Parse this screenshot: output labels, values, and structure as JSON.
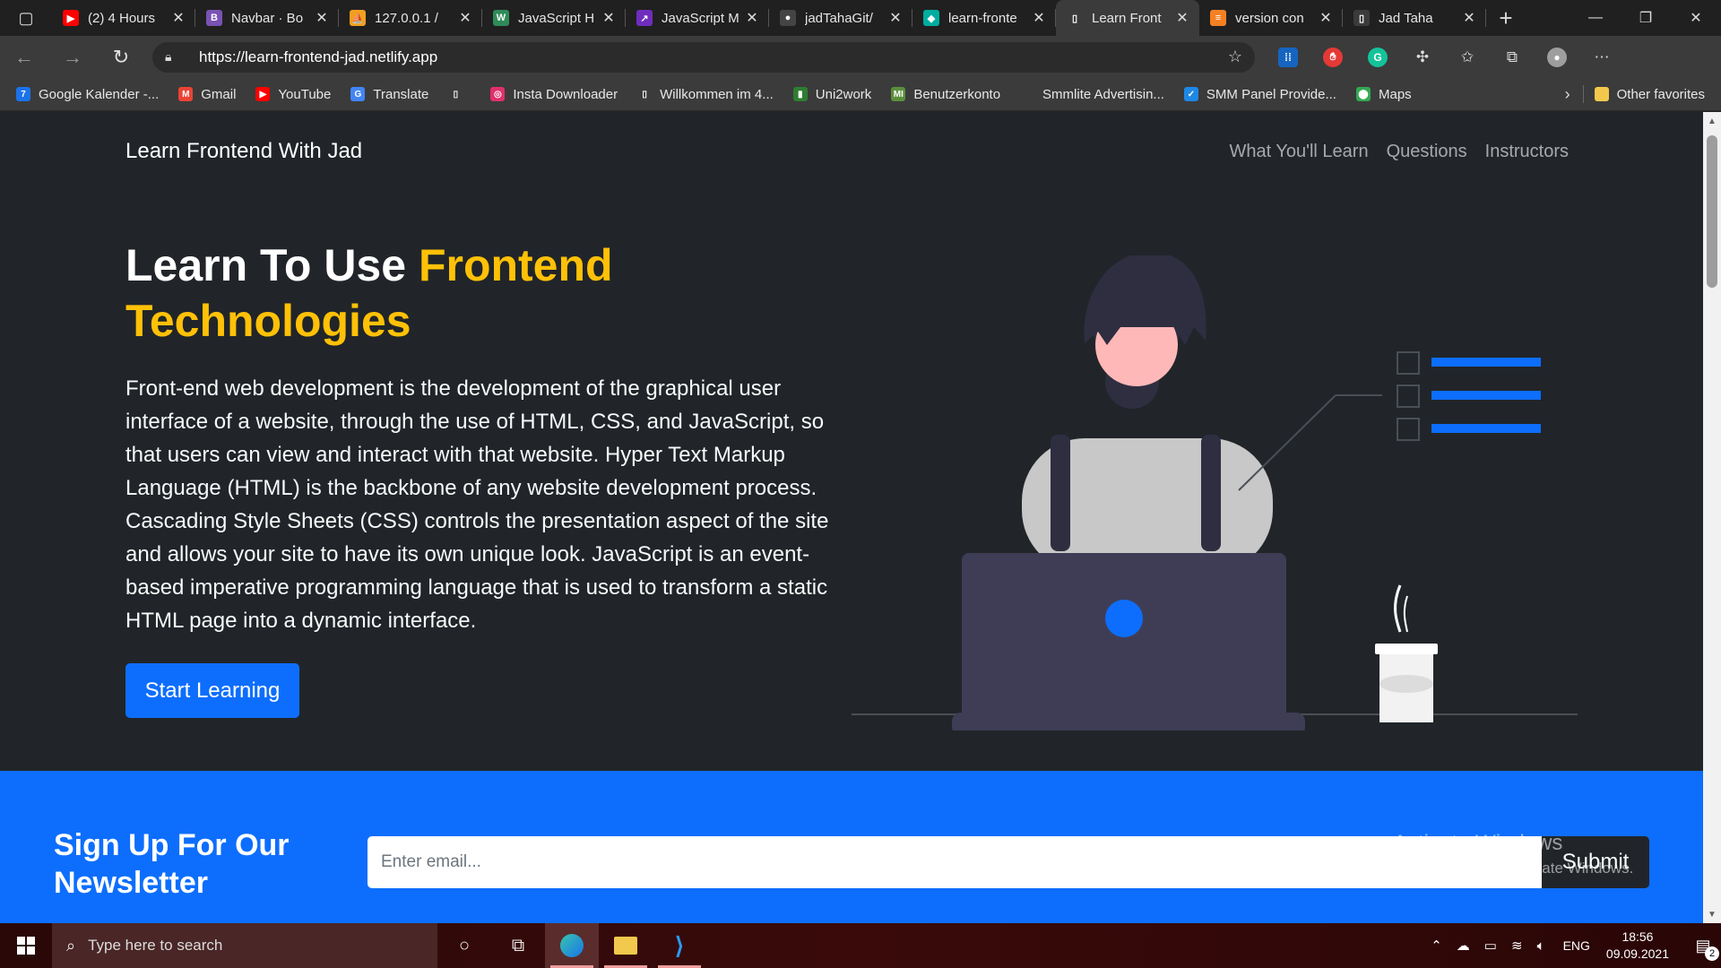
{
  "browser": {
    "tabs": [
      {
        "title": "(2) 4 Hours",
        "favicon_color": "#ff0000",
        "favicon_glyph": "▶"
      },
      {
        "title": "Navbar · Bo",
        "favicon_color": "#7952b3",
        "favicon_glyph": "B"
      },
      {
        "title": "127.0.0.1 / ",
        "favicon_color": "#f0a020",
        "favicon_glyph": "⛵"
      },
      {
        "title": "JavaScript H",
        "favicon_color": "#2e8b57",
        "favicon_glyph": "W"
      },
      {
        "title": "JavaScript M",
        "favicon_color": "#6f2dbd",
        "favicon_glyph": "↗"
      },
      {
        "title": "jadTahaGit/",
        "favicon_color": "#444444",
        "favicon_glyph": "●"
      },
      {
        "title": "learn-fronte",
        "favicon_color": "#00ad9f",
        "favicon_glyph": "◆"
      },
      {
        "title": "Learn Front",
        "favicon_color": "#3b3b3b",
        "favicon_glyph": "▯",
        "active": true
      },
      {
        "title": "version con",
        "favicon_color": "#f48024",
        "favicon_glyph": "≡"
      },
      {
        "title": "Jad Taha",
        "favicon_color": "#3b3b3b",
        "favicon_glyph": "▯"
      }
    ],
    "url": "https://learn-frontend-jad.netlify.app",
    "bookmarks": [
      {
        "label": "Google Kalender -...",
        "color": "#1a73e8",
        "glyph": "7"
      },
      {
        "label": "Gmail",
        "color": "#ea4335",
        "glyph": "M"
      },
      {
        "label": "YouTube",
        "color": "#ff0000",
        "glyph": "▶"
      },
      {
        "label": "Translate",
        "color": "#4285f4",
        "glyph": "G"
      },
      {
        "label": "",
        "color": "#3b3b3b",
        "glyph": "▯"
      },
      {
        "label": "Insta Downloader",
        "color": "#e1306c",
        "glyph": "◎"
      },
      {
        "label": "Willkommen im 4...",
        "color": "#3b3b3b",
        "glyph": "▯"
      },
      {
        "label": "Uni2work",
        "color": "#2e7d32",
        "glyph": "▮"
      },
      {
        "label": "Benutzerkonto",
        "color": "#5a8f3c",
        "glyph": "MI"
      },
      {
        "label": "Smmlite Advertisin...",
        "color": "#3b3b3b",
        "glyph": ""
      },
      {
        "label": "SMM Panel Provide...",
        "color": "#1e88e5",
        "glyph": "✓"
      },
      {
        "label": "Maps",
        "color": "#34a853",
        "glyph": "⬤"
      }
    ],
    "other_favorites": "Other favorites"
  },
  "site": {
    "brand": "Learn Frontend With Jad",
    "nav": [
      "What You'll Learn",
      "Questions",
      "Instructors"
    ],
    "hero": {
      "title_plain": "Learn To Use ",
      "title_highlight": "Frontend Technologies",
      "paragraph": "Front-end web development is the development of the graphical user interface of a website, through the use of HTML, CSS, and JavaScript, so that users can view and interact with that website. Hyper Text Markup Language (HTML) is the backbone of any website development process. Cascading Style Sheets (CSS) controls the presentation aspect of the site and allows your site to have its own unique look. JavaScript is an event-based imperative programming language that is used to transform a static HTML page into a dynamic interface.",
      "cta": "Start Learning"
    },
    "newsletter": {
      "title": "Sign Up For Our Newsletter",
      "placeholder": "Enter email...",
      "submit": "Submit"
    },
    "colors": {
      "accent": "#ffc107",
      "primary": "#0d6efd",
      "dark": "#212529"
    }
  },
  "watermark": {
    "line1": "Activate Windows",
    "line2": "Go to Settings to activate Windows."
  },
  "taskbar": {
    "search_placeholder": "Type here to search",
    "language": "ENG",
    "time": "18:56",
    "date": "09.09.2021",
    "notifications": "2"
  }
}
